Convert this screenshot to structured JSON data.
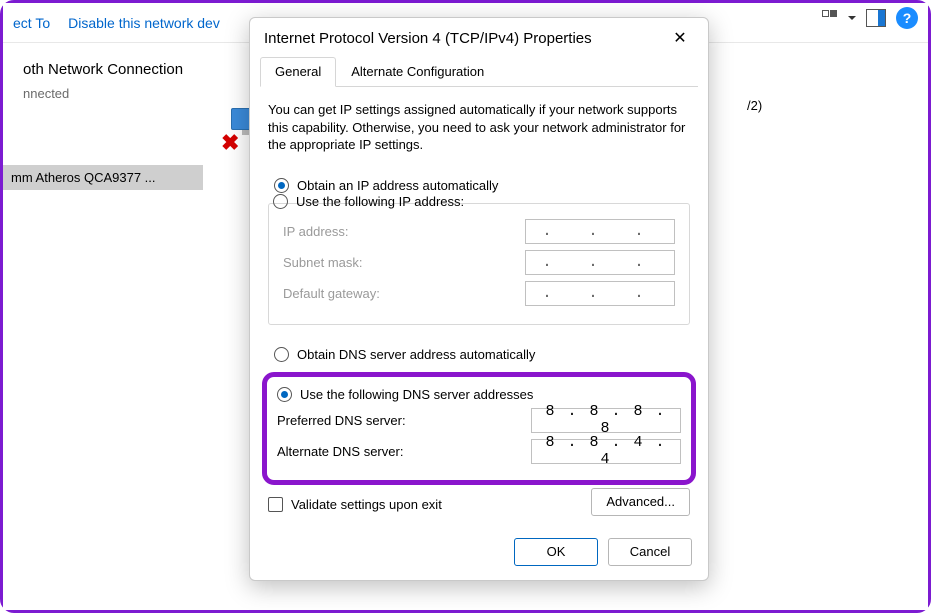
{
  "toolbar": {
    "connect_to": "ect To",
    "disable": "Disable this network dev"
  },
  "bg": {
    "conn_title": "oth Network Connection",
    "status": "nnected",
    "device": "mm Atheros QCA9377 ...",
    "v2": "/2)"
  },
  "dialog": {
    "title": "Internet Protocol Version 4 (TCP/IPv4) Properties",
    "tabs": {
      "general": "General",
      "alt": "Alternate Configuration"
    },
    "intro": "You can get IP settings assigned automatically if your network supports this capability. Otherwise, you need to ask your network administrator for the appropriate IP settings.",
    "ip": {
      "auto": "Obtain an IP address automatically",
      "manual": "Use the following IP address:",
      "addr_label": "IP address:",
      "mask_label": "Subnet mask:",
      "gw_label": "Default gateway:"
    },
    "dns": {
      "auto": "Obtain DNS server address automatically",
      "manual": "Use the following DNS server addresses",
      "pref_label": "Preferred DNS server:",
      "alt_label": "Alternate DNS server:",
      "pref_value": "8 . 8 . 8 . 8",
      "alt_value": "8 . 8 . 4 . 4"
    },
    "validate": "Validate settings upon exit",
    "advanced": "Advanced...",
    "ok": "OK",
    "cancel": "Cancel"
  },
  "dots": ".     .     ."
}
